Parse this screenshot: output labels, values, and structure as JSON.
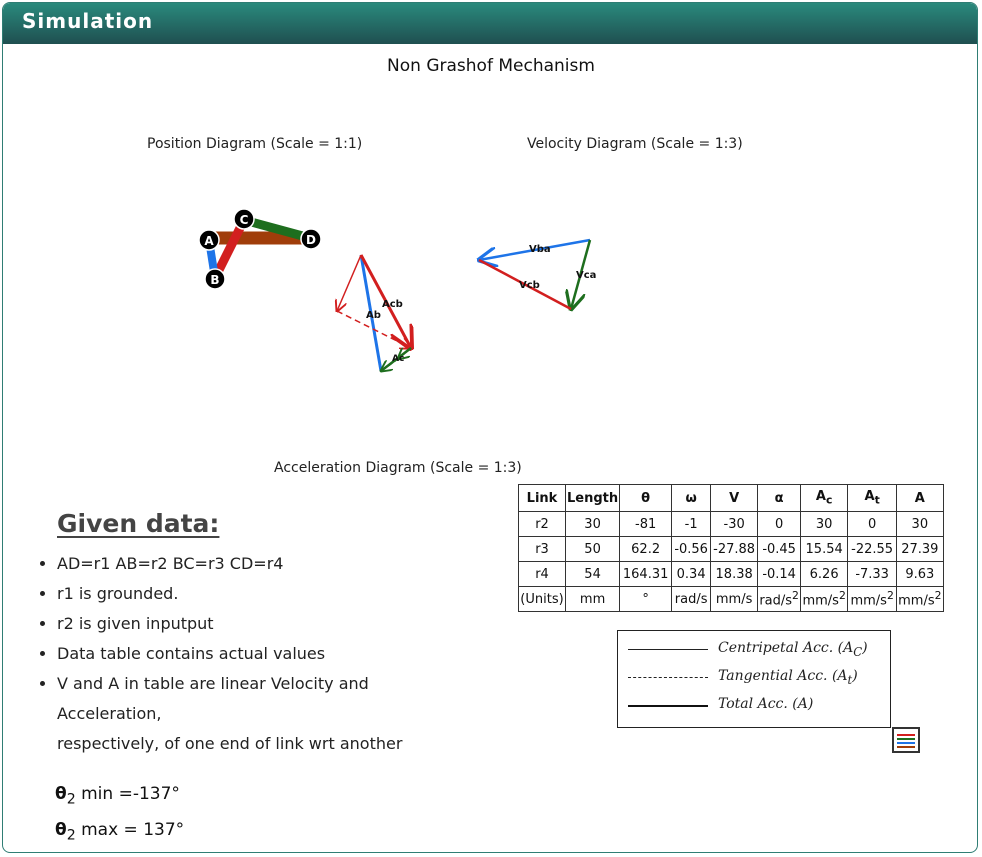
{
  "header": {
    "title": "Simulation"
  },
  "mechanism_title": "Non Grashof Mechanism",
  "captions": {
    "position": "Position Diagram (Scale = 1:1)",
    "velocity": "Velocity Diagram (Scale = 1:3)",
    "acceleration": "Acceleration Diagram (Scale = 1:3)"
  },
  "diagram_labels": {
    "joint_a": "A",
    "joint_b": "B",
    "joint_c": "C",
    "joint_d": "D",
    "vba": "Vba",
    "vca": "Vca",
    "vcb": "Vcb",
    "ab": "Ab",
    "acb": "Acb",
    "ac": "Ac"
  },
  "colors": {
    "header": "#1f6b63",
    "link_r2": "#1e74e8",
    "link_r3": "#d21f1f",
    "link_r4": "#1e6e1e",
    "ground": "#a03d0a"
  },
  "given": {
    "title": "Given data:",
    "items": [
      "AD=r1 AB=r2 BC=r3 CD=r4",
      "r1 is grounded.",
      "r2 is given inputput",
      "Data table contains actual values",
      "V and A in table are linear Velocity and Acceleration,",
      "respectively, of one end of link wrt another"
    ],
    "theta_min_label": "min =-137°",
    "theta_max_label": "max = 137°",
    "theta_symbol": "θ",
    "theta_sub": "2"
  },
  "table": {
    "headers": {
      "link": "Link",
      "length": "Length",
      "theta": "θ",
      "omega": "ω",
      "v": "V",
      "alpha": "α",
      "ac_base": "A",
      "ac_sub": "c",
      "at_base": "A",
      "at_sub": "t",
      "a": "A"
    },
    "rows": [
      [
        "r2",
        "30",
        "-81",
        "-1",
        "-30",
        "0",
        "30",
        "0",
        "30"
      ],
      [
        "r3",
        "50",
        "62.2",
        "-0.56",
        "-27.88",
        "-0.45",
        "15.54",
        "-22.55",
        "27.39"
      ],
      [
        "r4",
        "54",
        "164.31",
        "0.34",
        "18.38",
        "-0.14",
        "6.26",
        "-7.33",
        "9.63"
      ]
    ],
    "units": [
      "(Units)",
      "mm",
      "°",
      "rad/s",
      "mm/s",
      "rad/s",
      "mm/s",
      "mm/s",
      "mm/s"
    ],
    "unit_sup": "2"
  },
  "legend": {
    "centripetal": "Centripetal Acc. (A",
    "centripetal_sub": "C",
    "tangential": "Tangential Acc. (A",
    "tangential_sub": "t",
    "total": "Total Acc. (A)",
    "close": ")"
  }
}
